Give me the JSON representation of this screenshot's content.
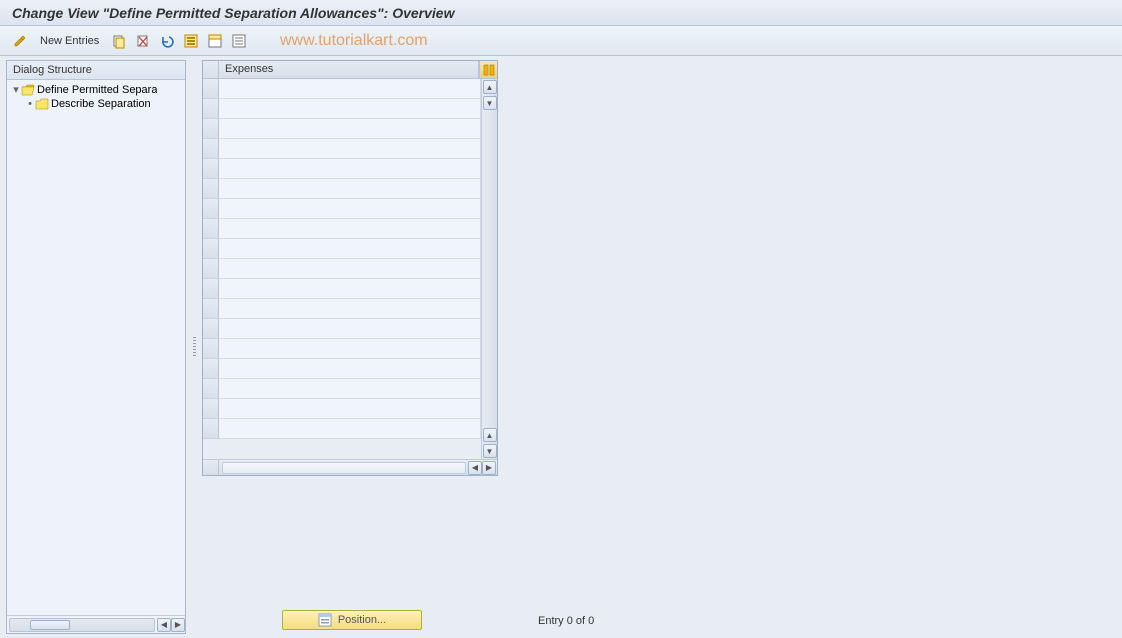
{
  "title": "Change View \"Define Permitted Separation Allowances\": Overview",
  "toolbar": {
    "new_entries_label": "New Entries"
  },
  "watermark": "www.tutorialkart.com",
  "dialog_structure": {
    "header": "Dialog Structure",
    "nodes": [
      {
        "label": "Define Permitted Separa",
        "expanded": true,
        "selected": false,
        "open": true
      },
      {
        "label": "Describe Separation",
        "expanded": false,
        "selected": false,
        "open": false
      }
    ]
  },
  "grid": {
    "column_header": "Expenses",
    "row_count": 18
  },
  "position_button_label": "Position...",
  "entry_status": "Entry 0 of 0"
}
